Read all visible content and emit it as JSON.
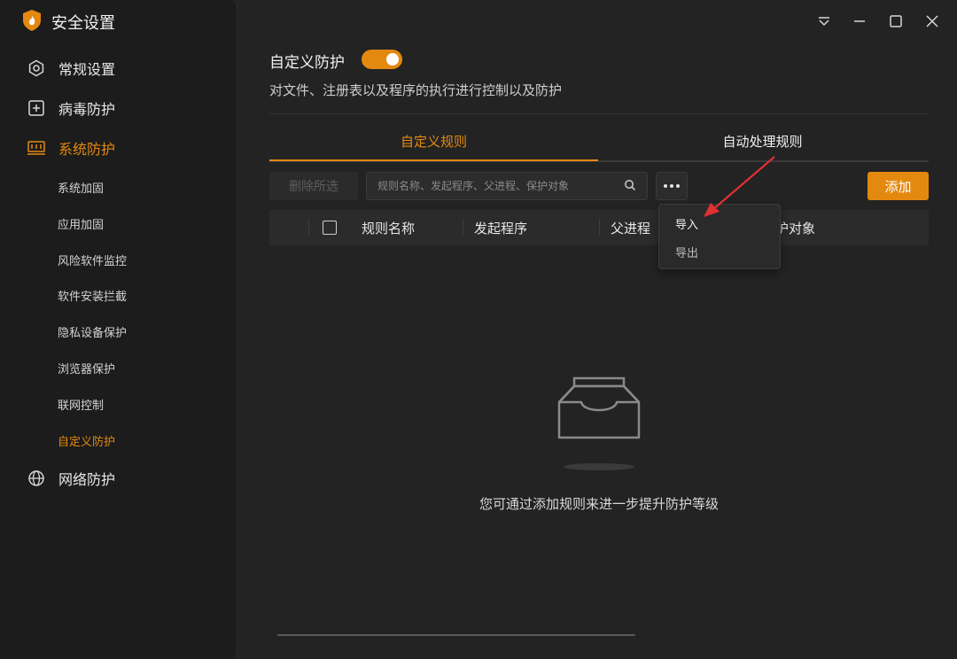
{
  "app": {
    "title": "安全设置",
    "accent": "#e4890f"
  },
  "sidebar": {
    "main_items": [
      {
        "label": "常规设置",
        "icon": "gear-icon"
      },
      {
        "label": "病毒防护",
        "icon": "plus-square-icon"
      },
      {
        "label": "系统防护",
        "icon": "system-icon",
        "active": true
      },
      {
        "label": "网络防护",
        "icon": "globe-icon"
      }
    ],
    "sub_items": [
      {
        "label": "系统加固"
      },
      {
        "label": "应用加固"
      },
      {
        "label": "风险软件监控"
      },
      {
        "label": "软件安装拦截"
      },
      {
        "label": "隐私设备保护"
      },
      {
        "label": "浏览器保护"
      },
      {
        "label": "联网控制"
      },
      {
        "label": "自定义防护",
        "active": true
      }
    ]
  },
  "main": {
    "heading": "自定义防护",
    "toggle_on": true,
    "description": "对文件、注册表以及程序的执行进行控制以及防护",
    "tabs": [
      {
        "label": "自定义规则",
        "active": true
      },
      {
        "label": "自动处理规则",
        "active": false
      }
    ],
    "toolbar": {
      "delete_label": "删除所选",
      "search_placeholder": "规则名称、发起程序、父进程、保护对象",
      "add_label": "添加"
    },
    "table": {
      "columns": [
        "规则名称",
        "发起程序",
        "父进程",
        "保护对象"
      ]
    },
    "dropdown": {
      "items": [
        "导入",
        "导出"
      ]
    },
    "empty_text": "您可通过添加规则来进一步提升防护等级"
  }
}
